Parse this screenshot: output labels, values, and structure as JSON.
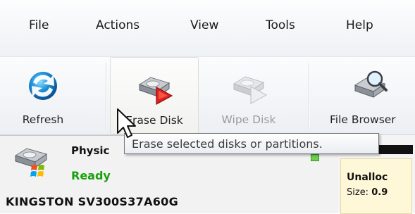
{
  "menu": {
    "items": [
      "File",
      "Actions",
      "View",
      "Tools",
      "Help"
    ]
  },
  "toolbar": {
    "refresh_label": "Refresh",
    "erase_disk_label": "Erase Disk",
    "wipe_disk_label": "Wipe Disk",
    "file_browser_label": "File Browser"
  },
  "tooltip": {
    "text": "Erase selected disks or partitions."
  },
  "disk": {
    "label": "Physic",
    "status": "Ready",
    "model": "KINGSTON SV300S37A60G"
  },
  "partition": {
    "type": "Unalloc",
    "size_label": "Size:",
    "size_value": "0.9"
  },
  "colors": {
    "status_ready": "#1aa10f",
    "erase_accent": "#e0201c",
    "partition_bg": "#fff8d8"
  }
}
